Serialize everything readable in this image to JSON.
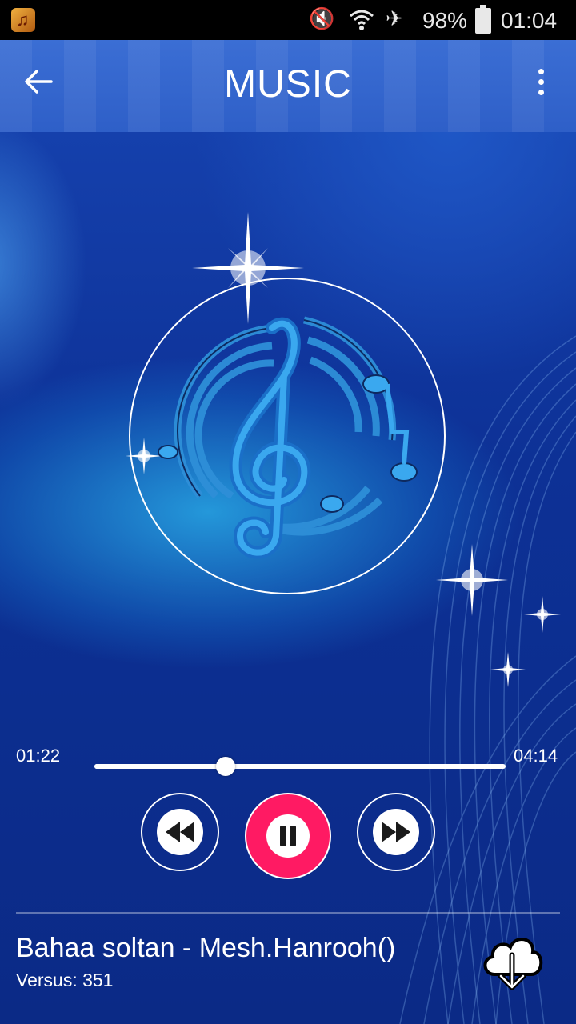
{
  "status_bar": {
    "app_icon": "music-app-icon",
    "icons": [
      "mute-icon",
      "wifi-icon",
      "airplane-icon",
      "battery-icon"
    ],
    "battery_percent": "98%",
    "clock": "01:04"
  },
  "app_bar": {
    "title": "MUSIC",
    "back_icon": "back-arrow-icon",
    "menu_icon": "overflow-menu-icon"
  },
  "artwork": {
    "icon": "treble-clef-music-notes-icon"
  },
  "player": {
    "elapsed": "01:22",
    "duration": "04:14",
    "progress_fraction": 0.32,
    "controls": {
      "rewind_icon": "rewind-icon",
      "pause_icon": "pause-icon",
      "forward_icon": "fast-forward-icon"
    }
  },
  "track": {
    "title": "Bahaa soltan - Mesh.Hanrooh()",
    "meta": "Versus: 351",
    "download_icon": "cloud-download-icon"
  },
  "colors": {
    "accent": "#ff1a63",
    "app_bar": "#2e5fc8",
    "background": "#0b2a86"
  }
}
